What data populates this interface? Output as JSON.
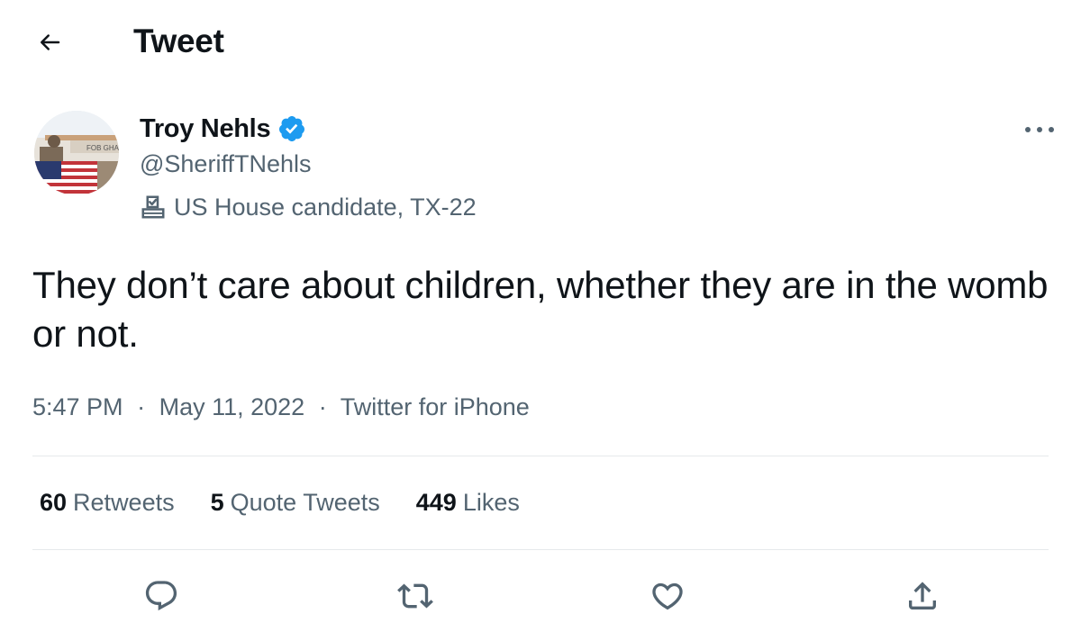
{
  "header": {
    "title": "Tweet",
    "back_icon": "arrow-left-icon"
  },
  "author": {
    "name": "Troy Nehls",
    "handle": "@SheriffTNehls",
    "verified_icon": "verified-badge-icon",
    "avatar_sign_text": "FOB GHA",
    "label_icon": "ballot-box-icon",
    "label": "US House candidate, TX-22"
  },
  "tweet": {
    "text": "They don’t care about children, whether they are in the womb or not.",
    "time": "5:47 PM",
    "separator": "·",
    "date": "May 11, 2022",
    "source": "Twitter for iPhone"
  },
  "stats": [
    {
      "count": "60",
      "label": "Retweets"
    },
    {
      "count": "5",
      "label": "Quote Tweets"
    },
    {
      "count": "449",
      "label": "Likes"
    }
  ],
  "actions": [
    {
      "name": "reply",
      "icon": "reply-icon"
    },
    {
      "name": "retweet",
      "icon": "retweet-icon"
    },
    {
      "name": "like",
      "icon": "heart-icon"
    },
    {
      "name": "share",
      "icon": "share-icon"
    }
  ],
  "colors": {
    "text_primary": "#0f1419",
    "text_secondary": "#536471",
    "verified_blue": "#1d9bf0",
    "divider": "#e6e9eb"
  }
}
